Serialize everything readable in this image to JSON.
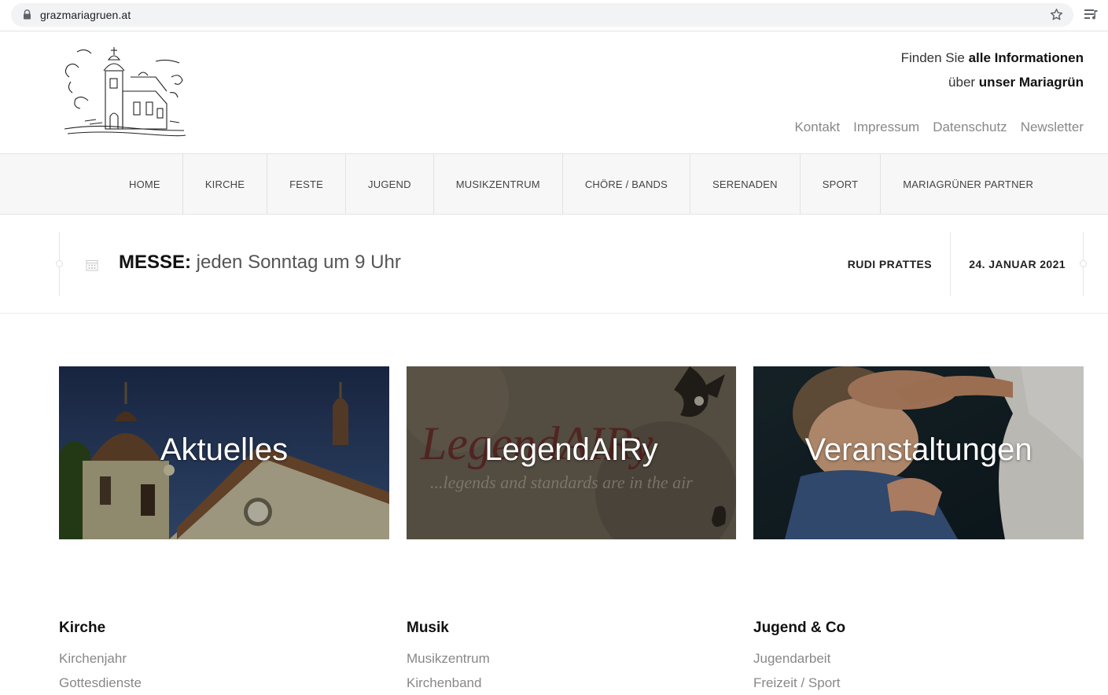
{
  "browser": {
    "url": "grazmariagruen.at"
  },
  "header": {
    "tagline_line1_prefix": "Finden Sie ",
    "tagline_line1_bold": "alle Informationen",
    "tagline_line2_prefix": "über ",
    "tagline_line2_bold": "unser Mariagrün",
    "top_links": [
      "Kontakt",
      "Impressum",
      "Datenschutz",
      "Newsletter"
    ]
  },
  "nav": {
    "items": [
      "HOME",
      "KIRCHE",
      "FESTE",
      "JUGEND",
      "MUSIKZENTRUM",
      "CHÖRE / BANDS",
      "SERENADEN",
      "SPORT",
      "MARIAGRÜNER PARTNER"
    ]
  },
  "infobar": {
    "messe_label": "MESSE:",
    "messe_text": " jeden Sonntag um 9 Uhr",
    "author": "RUDI PRATTES",
    "date": "24. JANUAR 2021"
  },
  "tiles": [
    {
      "title": "Aktuelles"
    },
    {
      "title": "LegendAIRy",
      "image_script_text": "LegendAIRy",
      "image_subtitle": "...legends and standards are in the air"
    },
    {
      "title": "Veranstaltungen"
    }
  ],
  "footer": {
    "columns": [
      {
        "heading": "Kirche",
        "links": [
          "Kirchenjahr",
          "Gottesdienste"
        ]
      },
      {
        "heading": "Musik",
        "links": [
          "Musikzentrum",
          "Kirchenband"
        ]
      },
      {
        "heading": "Jugend & Co",
        "links": [
          "Jugendarbeit",
          "Freizeit / Sport"
        ]
      }
    ]
  }
}
